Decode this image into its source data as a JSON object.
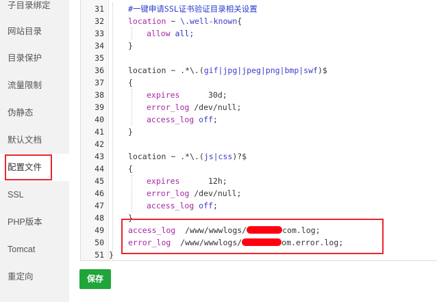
{
  "sidebar": {
    "items": [
      {
        "label": "子目录绑定",
        "active": false
      },
      {
        "label": "网站目录",
        "active": false
      },
      {
        "label": "目录保护",
        "active": false
      },
      {
        "label": "流量限制",
        "active": false
      },
      {
        "label": "伪静态",
        "active": false
      },
      {
        "label": "默认文档",
        "active": false
      },
      {
        "label": "配置文件",
        "active": true
      },
      {
        "label": "SSL",
        "active": false
      },
      {
        "label": "PHP版本",
        "active": false
      },
      {
        "label": "Tomcat",
        "active": false
      },
      {
        "label": "重定向",
        "active": false
      }
    ]
  },
  "editor": {
    "line_numbers": [
      "31",
      "32",
      "33",
      "34",
      "35",
      "36",
      "37",
      "38",
      "39",
      "40",
      "41",
      "42",
      "43",
      "44",
      "45",
      "46",
      "47",
      "48",
      "49",
      "50",
      "51"
    ],
    "lines": {
      "l31_comment": "#一键申请SSL证书验证目录相关设置",
      "l32_kw": "location",
      "l32_rest": " ~ ",
      "l32_pattern": "\\.well-known",
      "l32_brace": "{",
      "l33_kw": "allow",
      "l33_val": " all;",
      "l34": "}",
      "l36_kw": "location",
      "l36_rest": " ~ .*\\.(",
      "l36_ext": "gif|jpg|jpeg|png|bmp|swf",
      "l36_end": ")$",
      "l37": "{",
      "l38_kw": "expires",
      "l38_val": "      30d;",
      "l39_kw": "error_log",
      "l39_val": " /dev/null;",
      "l40_kw": "access_log",
      "l40_off": " off",
      "l40_semi": ";",
      "l41": "}",
      "l43_kw": "location",
      "l43_rest": " ~ .*\\.(",
      "l43_ext": "js|css",
      "l43_end": ")?$",
      "l44": "{",
      "l45_kw": "expires",
      "l45_val": "      12h;",
      "l46_kw": "error_log",
      "l46_val": " /dev/null;",
      "l47_kw": "access_log",
      "l47_off": " off",
      "l47_semi": ";",
      "l48": "}",
      "l49_kw": "access_log",
      "l49_pre": "  /www/wwwlogs/",
      "l49_post": "com.log;",
      "l50_kw": "error_log",
      "l50_pre": "  /www/wwwlogs/",
      "l50_post": "om.error.log;",
      "l51": "}"
    }
  },
  "actions": {
    "save_label": "保存"
  },
  "colors": {
    "accent_green": "#20a53a",
    "annotation_red": "#e8262b",
    "keyword": "#a526a4"
  }
}
